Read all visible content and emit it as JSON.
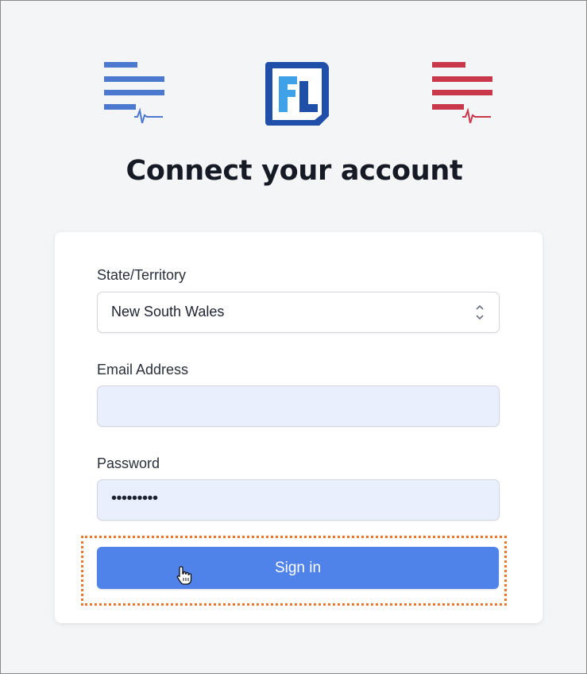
{
  "page": {
    "title": "Connect your account"
  },
  "logos": {
    "left": {
      "icon": "blue-document-heartbeat-icon",
      "color": "#4a79cf"
    },
    "center": {
      "icon": "fl-logo",
      "text": "FL",
      "color": "#1f4fa8",
      "accent": "#3fa1e8"
    },
    "right": {
      "icon": "red-document-heartbeat-icon",
      "color": "#c9374a"
    }
  },
  "form": {
    "state_label": "State/Territory",
    "state_value": "New South Wales",
    "email_label": "Email Address",
    "email_value": "",
    "password_label": "Password",
    "password_value": "•••••••••",
    "submit_label": "Sign in"
  },
  "colors": {
    "primary_button": "#4f83ea",
    "highlight_border": "#e8782f",
    "autofill_bg": "#e9effd"
  }
}
